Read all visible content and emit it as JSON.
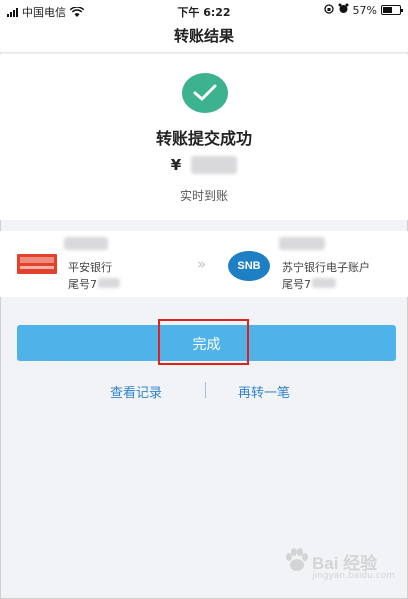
{
  "status_bar": {
    "carrier": "中国电信",
    "time": "下午 6:22",
    "battery": "57%",
    "battery_level": 0.57
  },
  "nav": {
    "title": "转账结果"
  },
  "result": {
    "status_text": "转账提交成功",
    "currency_symbol": "¥",
    "arrival_text": "实时到账"
  },
  "from_account": {
    "bank": "平安银行",
    "tail_label": "尾号7"
  },
  "to_account": {
    "bank": "苏宁银行电子账户",
    "tail_label": "尾号7",
    "logo_text": "SNB"
  },
  "actions": {
    "done_label": "完成",
    "records_link": "查看记录",
    "again_link": "再转一笔"
  },
  "watermark": {
    "brand": "Bai 经验",
    "url": "jingyan.baidu.com"
  },
  "colors": {
    "success": "#3cb28f",
    "primary_button": "#4fb3ea",
    "link": "#2f84c9",
    "highlight_box": "#e0211c"
  }
}
